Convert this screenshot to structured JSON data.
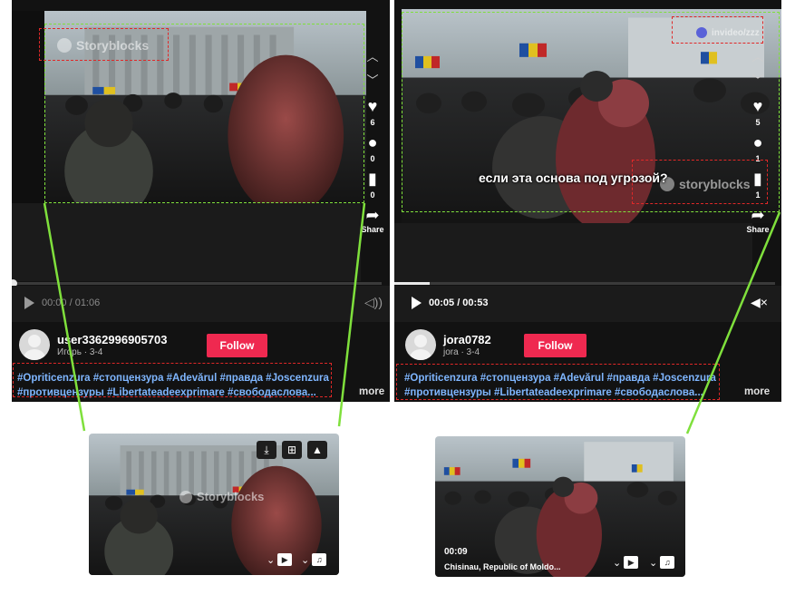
{
  "left": {
    "side": {
      "likes": "6",
      "comments": "0",
      "saves": "0",
      "share_label": "Share"
    },
    "time": "00:00 / 01:06",
    "progress": 0.0,
    "username": "user3362996905703",
    "subline": "Игорь · 3-4",
    "follow_label": "Follow",
    "watermark": "Storyblocks",
    "hashtags_line1": "#Opriticenzura #стопцензура #Adevărul #правда #Joscenzura",
    "hashtags_line2": "#противцензуры #Libertateadeexprimare #свободаслова...",
    "more_label": "more"
  },
  "right": {
    "side": {
      "likes": "5",
      "comments": "1",
      "saves": "1",
      "share_label": "Share"
    },
    "time": "00:05 / 00:53",
    "progress": 0.094,
    "username": "jora0782",
    "subline": "jora · 3-4",
    "follow_label": "Follow",
    "watermark_top": "invideo/zzz",
    "watermark": "storyblocks",
    "subtitle": "если эта основа под угрозой?",
    "hashtags_line1": "#Opriticenzura #стопцензура #Adevărul #правда #Joscenzura",
    "hashtags_line2": "#противцензуры #Libertateadeexprimare #свободаслова...",
    "more_label": "more"
  },
  "thumb_left": {
    "watermark": "Storyblocks"
  },
  "thumb_right": {
    "time": "00:09",
    "caption": "Chisinau, Republic of Moldo..."
  },
  "colors": {
    "accent_follow": "#ef2950",
    "annot_red": "#e02828",
    "annot_green": "#7fe03c",
    "hashtag": "#7fb6ff"
  }
}
